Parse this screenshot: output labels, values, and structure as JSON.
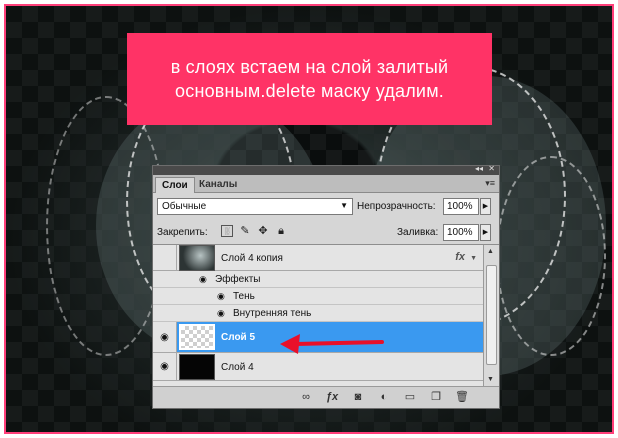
{
  "callout": {
    "line1": "в слоях встаем на слой залитый",
    "line2": "основным.delete маску удалим."
  },
  "panel": {
    "tabs": [
      {
        "label": "Слои",
        "active": true
      },
      {
        "label": "Каналы",
        "active": false
      }
    ],
    "titlebar_icons": [
      "collapse-icon",
      "close-icon"
    ],
    "blend_mode": "Обычные",
    "opacity_label": "Непрозрачность:",
    "opacity_value": "100%",
    "lock_label": "Закрепить:",
    "lock_icons": [
      "lock-transparent-icon",
      "lock-image-icon",
      "lock-position-icon",
      "lock-all-icon"
    ],
    "fill_label": "Заливка:",
    "fill_value": "100%"
  },
  "layers": [
    {
      "name": "Слой 4 копия",
      "visible": false,
      "has_fx": true,
      "fx_label": "fx",
      "effects_header": "Эффекты",
      "effects": [
        "Тень",
        "Внутренняя тень"
      ]
    },
    {
      "name": "Слой 5",
      "visible": true,
      "selected": true
    },
    {
      "name": "Слой 4",
      "visible": true
    }
  ],
  "footer_icons": [
    "link-layers-icon",
    "fx-icon",
    "add-mask-icon",
    "adjustment-layer-icon",
    "new-group-icon",
    "new-layer-icon",
    "trash-icon"
  ],
  "colors": {
    "callout_bg": "#ff3366",
    "frame_border": "#ff3f7a",
    "selected_layer": "#3a99f0",
    "arrow": "#e8102a"
  }
}
